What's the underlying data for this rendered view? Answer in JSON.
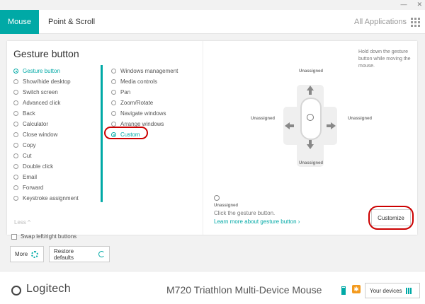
{
  "window": {
    "minimize_glyph": "—",
    "close_glyph": "✕"
  },
  "topbar": {
    "tab_mouse": "Mouse",
    "tab_point_scroll": "Point & Scroll",
    "all_applications": "All Applications",
    "apps_icon": "grid-icon",
    "active_color": "#00a9a6"
  },
  "gesture": {
    "title": "Gesture button",
    "left_options": [
      {
        "label": "Gesture button",
        "selected": true
      },
      {
        "label": "Show/hide desktop",
        "selected": false
      },
      {
        "label": "Switch screen",
        "selected": false
      },
      {
        "label": "Advanced click",
        "selected": false
      },
      {
        "label": "Back",
        "selected": false
      },
      {
        "label": "Calculator",
        "selected": false
      },
      {
        "label": "Close window",
        "selected": false
      },
      {
        "label": "Copy",
        "selected": false
      },
      {
        "label": "Cut",
        "selected": false
      },
      {
        "label": "Double click",
        "selected": false
      },
      {
        "label": "Email",
        "selected": false
      },
      {
        "label": "Forward",
        "selected": false
      },
      {
        "label": "Keystroke assignment",
        "selected": false
      }
    ],
    "right_options": [
      {
        "label": "Windows management",
        "selected": false
      },
      {
        "label": "Media controls",
        "selected": false
      },
      {
        "label": "Pan",
        "selected": false
      },
      {
        "label": "Zoom/Rotate",
        "selected": false
      },
      {
        "label": "Navigate windows",
        "selected": false
      },
      {
        "label": "Arrange windows",
        "selected": false
      },
      {
        "label": "Custom",
        "selected": true
      }
    ],
    "less": "Less ^",
    "hint": "Hold down the gesture button while moving the mouse.",
    "directions": {
      "up": "Unassigned",
      "down": "Unassigned",
      "left": "Unassigned",
      "right": "Unassigned"
    },
    "status_title": "Unassigned",
    "status_text": "Click the gesture button.",
    "learn_more": "Learn more about gesture button ›",
    "customize": "Customize",
    "highlight_color": "#cc0000"
  },
  "controls": {
    "swap_buttons": "Swap left/right buttons",
    "more": "More",
    "restore_defaults": "Restore defaults"
  },
  "footer": {
    "brand": "Logitech",
    "device_name": "M720 Triathlon Multi-Device Mouse",
    "your_devices": "Your devices",
    "battery_icon": "battery-icon",
    "bluetooth_icon": "bluetooth-icon"
  }
}
